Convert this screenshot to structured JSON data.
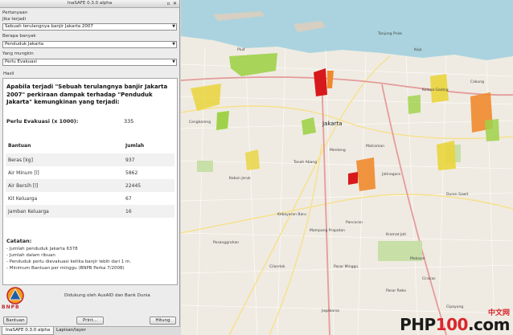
{
  "window": {
    "title": "InaSAFE 0.3.0 alpha",
    "float_glyph": "▫",
    "close_glyph": "✕"
  },
  "form": {
    "hazard_label": "Pertanyaan",
    "hazard_sub_label": "Jika terjadi",
    "hazard_value": "Sebuah terulangnya banjir Jakarta 2007",
    "exposure_label": "Berapa banyak",
    "exposure_value": "Penduduk Jakarta",
    "function_label": "Yang mungkin",
    "function_value": "Perlu Evakuasi"
  },
  "results": {
    "label": "Hasil",
    "headline": "Apabila terjadi \"Sebuah terulangnya banjir Jakarta 2007\" perkiraan dampak terhadap \"Penduduk Jakarta\" kemungkinan yang terjadi:",
    "evac_label": "Perlu Evakuasi (x 1000):",
    "evac_value": "335",
    "table": {
      "headers": [
        "Bantuan",
        "Jumlah"
      ],
      "rows": [
        [
          "Beras [kg]",
          "937"
        ],
        [
          "Air Minum [l]",
          "5862"
        ],
        [
          "Air Bersih [l]",
          "22445"
        ],
        [
          "Kit Keluarga",
          "67"
        ],
        [
          "Jamban Keluarga",
          "16"
        ]
      ]
    },
    "notes_title": "Catatan:",
    "notes": [
      "- Jumlah penduduk Jakarta 6378",
      "- Jumlah dalam ribuan",
      "- Penduduk perlu dievakuasi ketika banjir lebih dari 1 m.",
      "- Minimum Bantuan per minggu (BNPB Perka 7/2008)"
    ]
  },
  "footer": {
    "logo_text": "BNPB",
    "support_text": "Didukung oleh AusAID dan Bank Dunia",
    "buttons": {
      "help": "Bantuan",
      "print": "Print...",
      "run": "Hitung"
    },
    "tabs": [
      "InaSAFE 0.3.0 alpha",
      "Lapisan/layer"
    ]
  },
  "map": {
    "labels": [
      "Jakarta",
      "Tanjung Priok",
      "Koja",
      "Pluit",
      "Kelapa Gading",
      "Cakung",
      "Cengkareng",
      "Kebon Jeruk",
      "Tanah Abang",
      "Menteng",
      "Matraman",
      "Jatinegara",
      "Duren Sawit",
      "Kebayoran Baru",
      "Mampang Prapatan",
      "Pancoran",
      "Pasar Minggu",
      "Kramat Jati",
      "Cilandak",
      "Pesanggrahan",
      "Jagakarsa",
      "Pasar Rebo",
      "Ciracas",
      "Cipayung",
      "Makasar"
    ],
    "colors": {
      "water": "#aad3df",
      "land": "#efebe2",
      "flood_low": "#9fd24a",
      "flood_mid": "#e9d53c",
      "flood_high": "#ef8a2c",
      "flood_severe": "#d7191c"
    }
  },
  "watermark": {
    "prefix": "PHP",
    "highlight": "100",
    "suffix": ".com",
    "cn": "中文网"
  }
}
